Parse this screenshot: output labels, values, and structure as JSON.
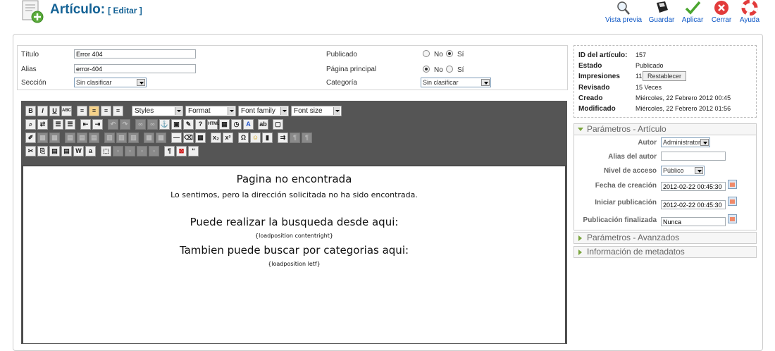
{
  "header": {
    "title": "Artículo:",
    "subtitle": "[ Editar ]",
    "toolbar": {
      "preview": "Vista previa",
      "save": "Guardar",
      "apply": "Aplicar",
      "close": "Cerrar",
      "help": "Ayuda"
    }
  },
  "details": {
    "title_label": "Título",
    "title_value": "Error 404",
    "alias_label": "Alias",
    "alias_value": "error-404",
    "section_label": "Sección",
    "section_value": "Sin clasificar",
    "published_label": "Publicado",
    "frontpage_label": "Página principal",
    "category_label": "Categoría",
    "category_value": "Sin clasificar",
    "no": "No",
    "yes": "Sí",
    "published_selected": "yes",
    "frontpage_selected": "no"
  },
  "editor": {
    "styles": "Styles",
    "format": "Format",
    "font_family": "Font family",
    "font_size": "Font size",
    "content": {
      "heading1": "Pagina no encontrada",
      "para1": "Lo sentimos, pero la dirección solicitada no ha sido encontrada.",
      "heading2": "Puede realizar la busqueda desde aqui:",
      "tag1": "{loadposition contentright}",
      "heading3": "Tambien puede buscar por categorias aqui:",
      "tag2": "{loadposition letf}"
    }
  },
  "info": {
    "id_label": "ID del artículo:",
    "id_value": "157",
    "state_label": "Estado",
    "state_value": "Publicado",
    "hits_label": "Impresiones",
    "hits_value": "11",
    "reset_label": "Restablecer",
    "revised_label": "Revisado",
    "revised_value": "15 Veces",
    "created_label": "Creado",
    "created_value": "Miércoles, 22 Febrero 2012 00:45",
    "modified_label": "Modificado",
    "modified_value": "Miércoles, 22 Febrero 2012 01:56"
  },
  "params": {
    "header": "Parámetros - Artículo",
    "author_label": "Autor",
    "author_value": "Administrator",
    "author_alias_label": "Alias del autor",
    "author_alias_value": "",
    "access_label": "Nivel de acceso",
    "access_value": "Público",
    "created_date_label": "Fecha de creación",
    "created_date_value": "2012-02-22 00:45:30",
    "publish_up_label": "Iniciar publicación",
    "publish_up_value": "2012-02-22 00:45:30",
    "publish_down_label": "Publicación finalizada",
    "publish_down_value": "Nunca"
  },
  "advanced": {
    "header": "Parámetros - Avanzados"
  },
  "metadata": {
    "header": "Información de metadatos"
  },
  "colors": {
    "title_blue": "#146295",
    "link_blue": "#0b55c4",
    "accent_green": "#7aa53c"
  }
}
